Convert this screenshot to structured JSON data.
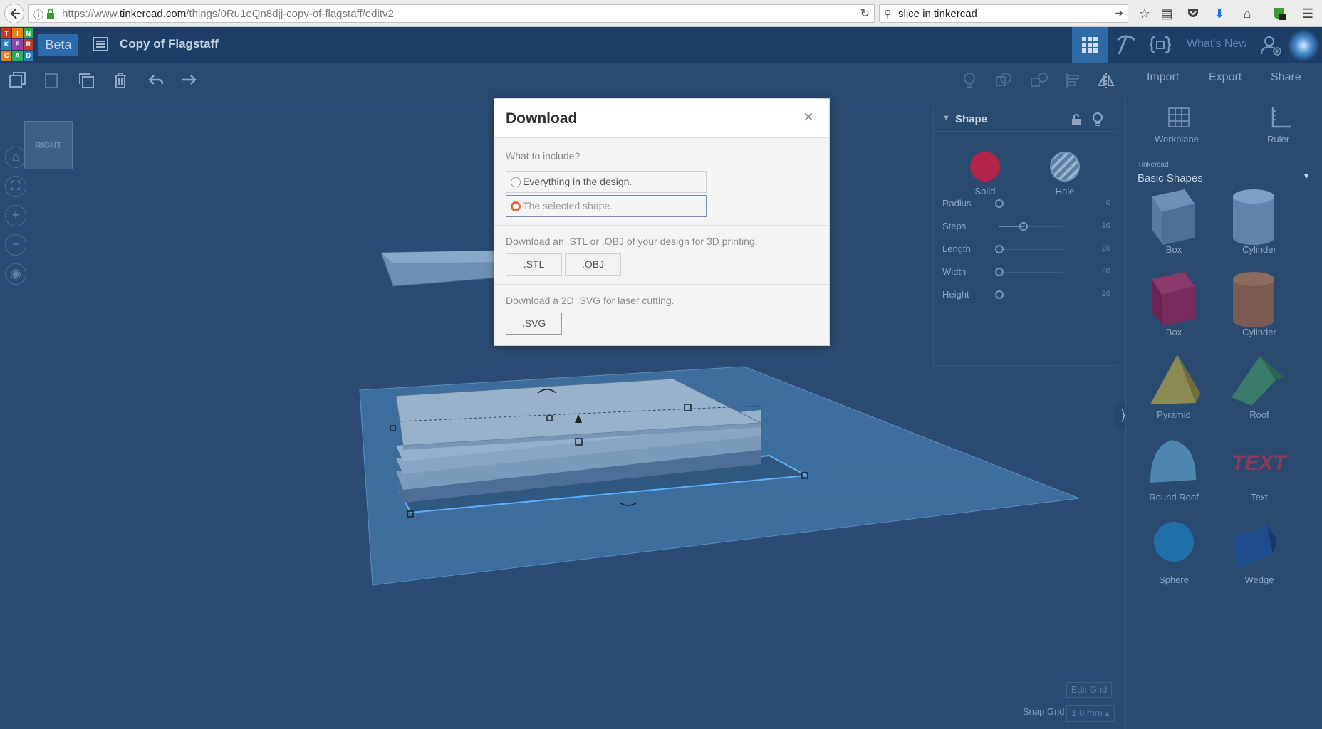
{
  "browser": {
    "url_prefix": "https://www.",
    "url_domain": "tinkercad.com",
    "url_path": "/things/0Ru1eQn8djj-copy-of-flagstaff/editv2",
    "search_text": "slice in tinkercad"
  },
  "app": {
    "logo_letters": [
      "T",
      "I",
      "N",
      "K",
      "E",
      "R",
      "C",
      "A",
      "D"
    ],
    "beta_label": "Beta",
    "design_title": "Copy of Flagstaff",
    "whats_new_label": "What's New"
  },
  "toolbar": {
    "import_label": "Import",
    "export_label": "Export",
    "share_label": "Share"
  },
  "viewport": {
    "viewcube_label": "RIGHT",
    "edit_grid_label": "Edit Grid",
    "snap_grid_label": "Snap Grid",
    "snap_grid_value": "1.0 mm ▴"
  },
  "inspector": {
    "title": "Shape",
    "solid_label": "Solid",
    "hole_label": "Hole",
    "properties": [
      {
        "label": "Radius",
        "value": "0",
        "level": 0.0
      },
      {
        "label": "Steps",
        "value": "10",
        "level": 0.38
      },
      {
        "label": "Length",
        "value": "20",
        "level": 0.0
      },
      {
        "label": "Width",
        "value": "20",
        "level": 0.0
      },
      {
        "label": "Height",
        "value": "20",
        "level": 0.0
      }
    ]
  },
  "library": {
    "workplane_label": "Workplane",
    "ruler_label": "Ruler",
    "source_label": "Tinkercad",
    "category_label": "Basic Shapes",
    "items": [
      {
        "label": "Box"
      },
      {
        "label": "Cylinder"
      },
      {
        "label": "Box"
      },
      {
        "label": "Cylinder"
      },
      {
        "label": "Pyramid"
      },
      {
        "label": "Roof"
      },
      {
        "label": "Round Roof"
      },
      {
        "label": "Text"
      },
      {
        "label": "Sphere"
      },
      {
        "label": "Wedge"
      }
    ],
    "text_shape_glyph": "TEXT"
  },
  "modal": {
    "title": "Download",
    "close_glyph": "×",
    "include_question": "What to include?",
    "option_everything": "Everything in the design.",
    "option_selected": "The selected shape.",
    "selected_option": "The selected shape.",
    "print_description": "Download an .STL or .OBJ of your design for 3D printing.",
    "stl_label": ".STL",
    "obj_label": ".OBJ",
    "laser_description": "Download a 2D .SVG for laser cutting.",
    "svg_label": ".SVG"
  },
  "colors": {
    "solid_swatch": "#b2244a",
    "selected_radio": "#e86a3c",
    "header_bg": "#1d3e66"
  }
}
